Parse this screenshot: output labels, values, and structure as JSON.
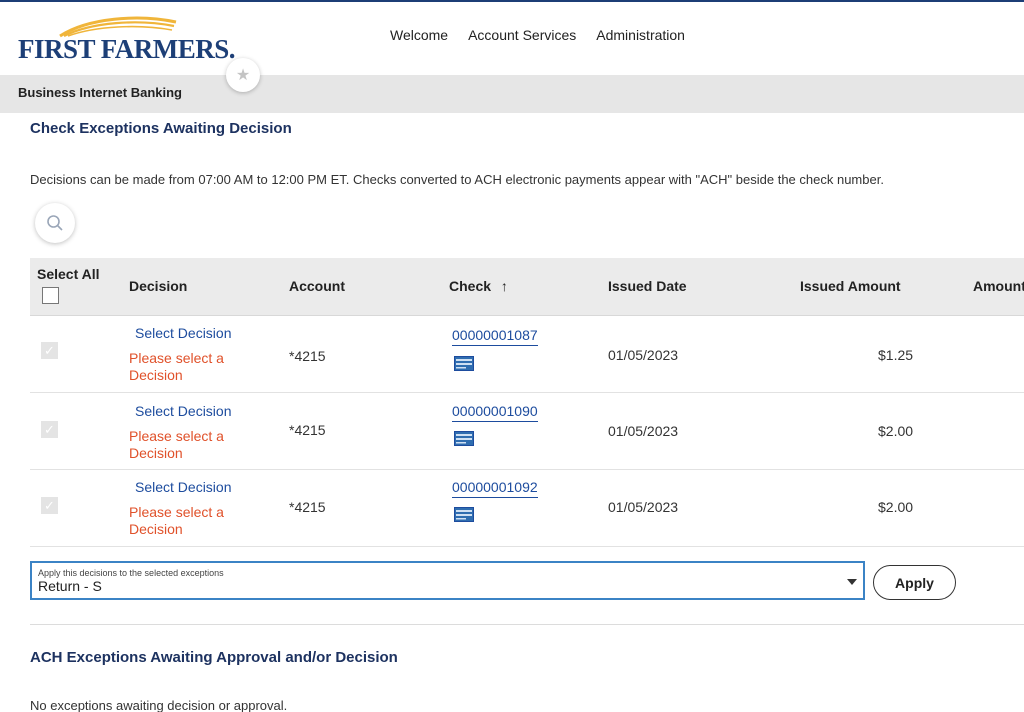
{
  "brand": {
    "name": "FIRST FARMERS."
  },
  "nav": {
    "items": [
      "Welcome",
      "Account Services",
      "Administration"
    ]
  },
  "subheader": {
    "title": "Business Internet Banking"
  },
  "check_section": {
    "title": "Check Exceptions Awaiting Decision",
    "info": "Decisions can be made from 07:00 AM to 12:00 PM ET. Checks converted to ACH electronic payments appear with \"ACH\" beside the check number."
  },
  "table": {
    "headers": {
      "select_all": "Select All",
      "decision": "Decision",
      "account": "Account",
      "check": "Check",
      "sort_arrow": "↑",
      "issued_date": "Issued Date",
      "issued_amount": "Issued Amount",
      "amount": "Amount"
    },
    "rows": [
      {
        "decision_link": "Select Decision",
        "error": "Please select a Decision",
        "account": "*4215",
        "check": "00000001087",
        "issued_date": "01/05/2023",
        "issued_amount": "$1.25"
      },
      {
        "decision_link": "Select Decision",
        "error": "Please select a Decision",
        "account": "*4215",
        "check": "00000001090",
        "issued_date": "01/05/2023",
        "issued_amount": "$2.00"
      },
      {
        "decision_link": "Select Decision",
        "error": "Please select a Decision",
        "account": "*4215",
        "check": "00000001092",
        "issued_date": "01/05/2023",
        "issued_amount": "$2.00"
      }
    ]
  },
  "apply": {
    "select_label": "Apply this decisions to the selected exceptions",
    "select_value": "Return - S",
    "button_label": "Apply"
  },
  "ach_section": {
    "title": "ACH Exceptions Awaiting Approval and/or Decision",
    "empty_text": "No exceptions awaiting decision or approval."
  },
  "colors": {
    "brand_navy": "#1d3f77",
    "link_blue": "#1d4c9e",
    "error_red": "#e0512a",
    "focus_blue": "#3b83c5",
    "logo_gold": "#f0b53a"
  },
  "icons": {
    "favorite": "star-icon",
    "search": "search-icon",
    "check_image": "check-image-icon",
    "dropdown": "caret-down-icon"
  }
}
